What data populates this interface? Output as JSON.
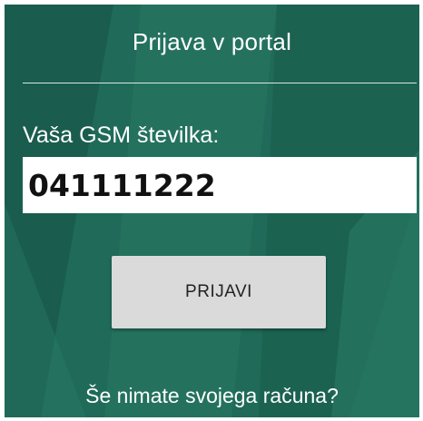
{
  "header": {
    "title": "Prijava v portal"
  },
  "form": {
    "phone_label": "Vaša GSM številka:",
    "phone_value": "041111222",
    "submit_label": "PRIJAVI"
  },
  "footer": {
    "signup_link": "Še nimate svojega računa?"
  },
  "colors": {
    "background": "#1f6a58",
    "background_shape_light": "#2a7a66",
    "background_shape_dark": "#175646",
    "text": "#ffffff",
    "button": "#dadada"
  }
}
